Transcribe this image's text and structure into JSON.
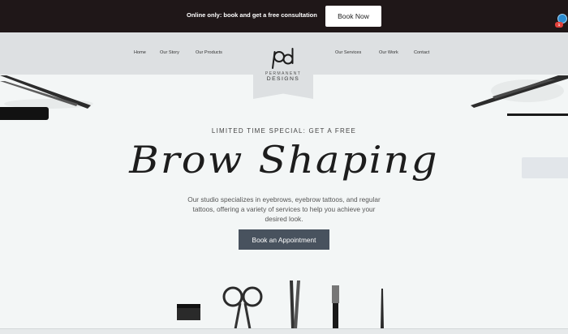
{
  "top_bar": {
    "promo_text": "Online only: book and get a free consultation",
    "book_now_label": "Book Now",
    "chat_badge_count": "1"
  },
  "nav": {
    "left_links": [
      "Home",
      "Our Story",
      "Our Products"
    ],
    "right_links": [
      "Our Services",
      "Our Work",
      "Contact"
    ],
    "logo": {
      "monogram": "pd",
      "line1": "PERMANENT",
      "line2": "DESIGNS"
    }
  },
  "hero": {
    "eyebrow": "LIMITED TIME SPECIAL: GET A FREE",
    "headline": "Brow Shaping",
    "description": "Our studio specializes in eyebrows, eyebrow tattoos, and regular tattoos, offering a variety of services to help you achieve your desired look.",
    "cta_label": "Book an Appointment"
  },
  "colors": {
    "top_bar_bg": "#1f1718",
    "nav_bg": "#dde0e2",
    "page_bg": "#f3f6f6",
    "cta_bg": "#48525e"
  },
  "icons": [
    "chat-icon",
    "logo-mark-icon"
  ]
}
